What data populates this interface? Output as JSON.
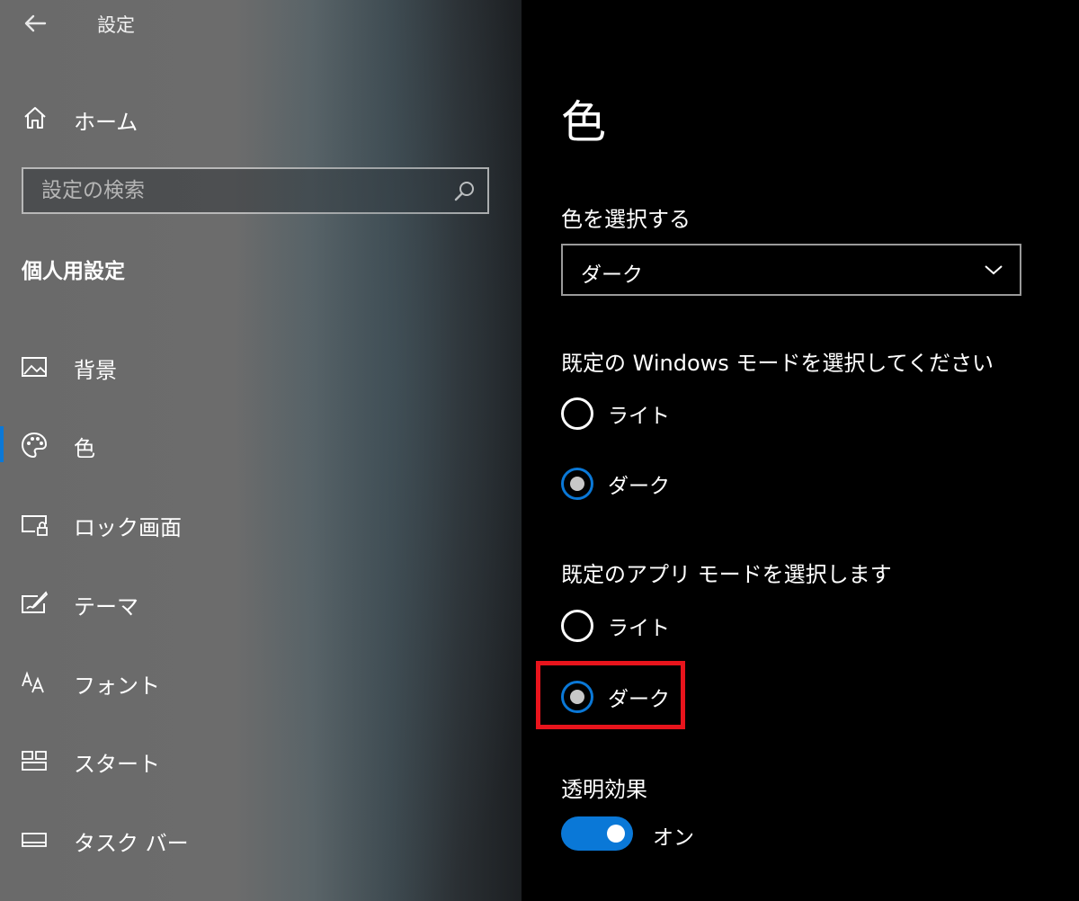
{
  "window": {
    "title": "設定"
  },
  "sidebar": {
    "home_label": "ホーム",
    "search_placeholder": "設定の検索",
    "section_title": "個人用設定",
    "items": [
      {
        "label": "背景",
        "icon": "picture-icon"
      },
      {
        "label": "色",
        "icon": "palette-icon",
        "active": true
      },
      {
        "label": "ロック画面",
        "icon": "lock-screen-icon"
      },
      {
        "label": "テーマ",
        "icon": "theme-brush-icon"
      },
      {
        "label": "フォント",
        "icon": "font-icon"
      },
      {
        "label": "スタート",
        "icon": "start-grid-icon"
      },
      {
        "label": "タスク バー",
        "icon": "taskbar-icon"
      }
    ]
  },
  "main": {
    "heading": "色",
    "choose_color_label": "色を選択する",
    "choose_color_value": "ダーク",
    "windows_mode": {
      "label": "既定の Windows モードを選択してください",
      "options": [
        {
          "label": "ライト",
          "selected": false
        },
        {
          "label": "ダーク",
          "selected": true
        }
      ]
    },
    "app_mode": {
      "label": "既定のアプリ モードを選択します",
      "options": [
        {
          "label": "ライト",
          "selected": false
        },
        {
          "label": "ダーク",
          "selected": true
        }
      ]
    },
    "transparency": {
      "label": "透明効果",
      "state_label": "オン",
      "on": true
    }
  },
  "colors": {
    "accent": "#0a78d7",
    "highlight": "#e8141c",
    "background": "#000000"
  }
}
